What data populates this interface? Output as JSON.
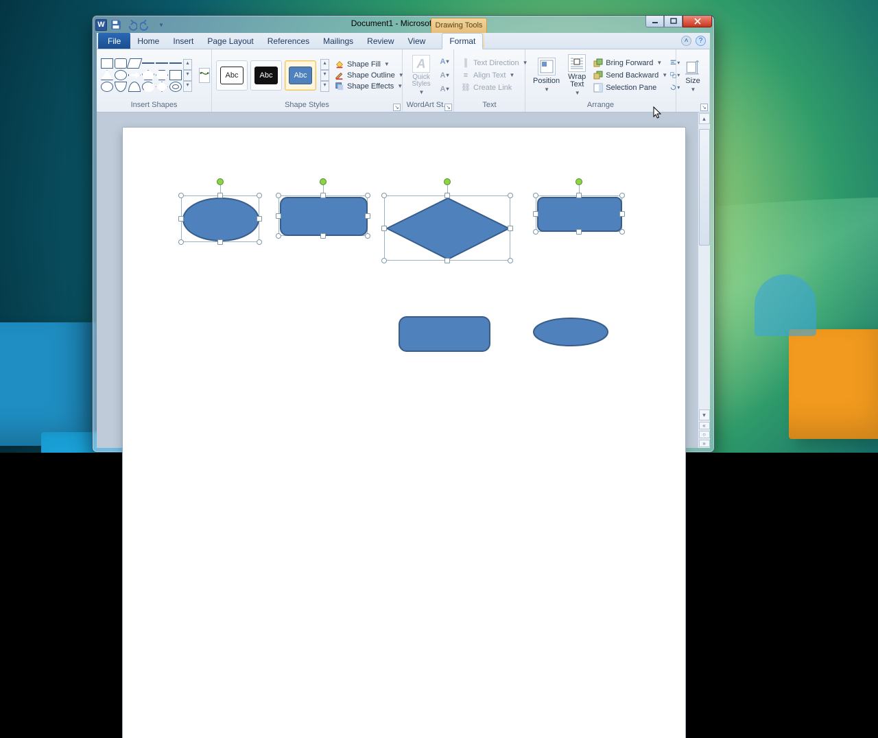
{
  "title": "Document1 - Microsoft Word",
  "context_header": "Drawing Tools",
  "tabs": {
    "file": "File",
    "list": [
      "Home",
      "Insert",
      "Page Layout",
      "References",
      "Mailings",
      "Review",
      "View"
    ],
    "context": "Format"
  },
  "groups": {
    "insert_shapes": "Insert Shapes",
    "shape_styles": "Shape Styles",
    "wordart": "WordArt St...",
    "text": "Text",
    "arrange": "Arrange",
    "size": "Size"
  },
  "shape_styles": {
    "thumb_label": "Abc",
    "fill": "Shape Fill",
    "outline": "Shape Outline",
    "effects": "Shape Effects"
  },
  "wordart": {
    "quick": "Quick Styles"
  },
  "text_group": {
    "direction": "Text Direction",
    "align": "Align Text",
    "link": "Create Link"
  },
  "arrange": {
    "position": "Position",
    "wrap": "Wrap Text",
    "forward": "Bring Forward",
    "backward": "Send Backward",
    "pane": "Selection Pane"
  },
  "size": "Size"
}
